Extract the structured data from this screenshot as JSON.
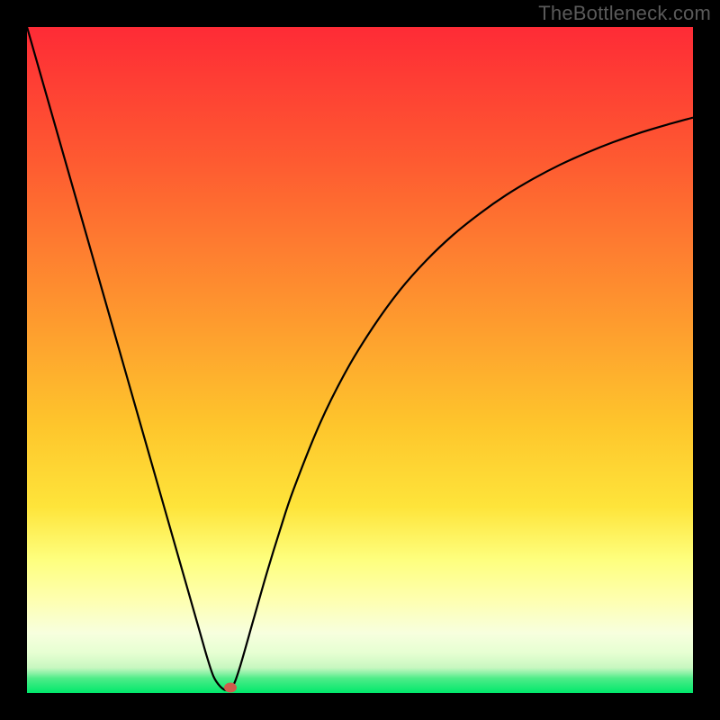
{
  "watermark": "TheBottleneck.com",
  "colors": {
    "top": "#fe2b36",
    "mid_upper": "#fe8f2f",
    "mid": "#fed72b",
    "mid_lower": "#feff7e",
    "green": "#00e86b",
    "black": "#000000",
    "curve": "#000000",
    "marker": "#cf5c4c"
  },
  "chart_data": {
    "type": "line",
    "title": "",
    "xlabel": "",
    "ylabel": "",
    "xlim": [
      0,
      100
    ],
    "ylim": [
      0,
      100
    ],
    "x": [
      0,
      2,
      4,
      6,
      8,
      10,
      12,
      14,
      16,
      18,
      20,
      22,
      24,
      26,
      27,
      28,
      29,
      30,
      31,
      32,
      34,
      36,
      38,
      40,
      44,
      48,
      52,
      56,
      60,
      64,
      68,
      72,
      76,
      80,
      84,
      88,
      92,
      96,
      100
    ],
    "values": [
      100,
      93,
      86,
      79,
      72,
      65,
      58,
      51,
      44,
      37,
      30,
      23,
      16,
      9,
      5.5,
      2.5,
      1,
      0.4,
      1.2,
      4,
      11,
      18,
      24.5,
      30.5,
      40.5,
      48.5,
      55,
      60.5,
      65,
      68.8,
      72,
      74.8,
      77.2,
      79.3,
      81.1,
      82.7,
      84.1,
      85.3,
      86.4
    ],
    "optimum_x": 29.5,
    "marker": {
      "x": 30.5,
      "y": 0.8
    },
    "gradient_bands": [
      {
        "from": 0,
        "to": 68,
        "color_top": "#fe2b36",
        "color_bottom": "#fed72b"
      },
      {
        "from": 68,
        "to": 82,
        "color_top": "#fed72b",
        "color_bottom": "#feff7e"
      },
      {
        "from": 82,
        "to": 92,
        "color_top": "#feff7e",
        "color_bottom": "#f7ffde"
      },
      {
        "from": 92,
        "to": 96.5,
        "color_top": "#f7ffde",
        "color_bottom": "#d8ffc8"
      },
      {
        "from": 96.5,
        "to": 100,
        "color_top": "#69f098",
        "color_bottom": "#00e86b"
      }
    ]
  }
}
